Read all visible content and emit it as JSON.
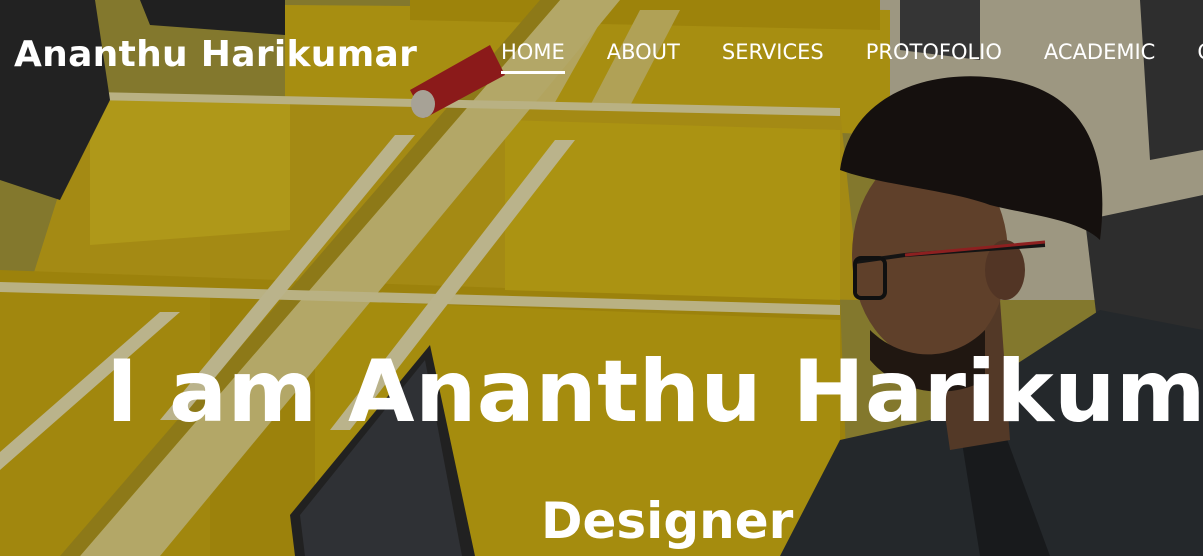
{
  "brand": "Ananthu Harikumar",
  "nav": {
    "items": [
      "HOME",
      "ABOUT",
      "SERVICES",
      "PROTOFOLIO",
      "ACADEMIC",
      "C"
    ]
  },
  "hero": {
    "headline": "I am Ananthu Harikumar",
    "role": "Designer"
  },
  "colors": {
    "desk_yellow": "#d9b90f",
    "overlay": "#000000",
    "text": "#ffffff"
  }
}
